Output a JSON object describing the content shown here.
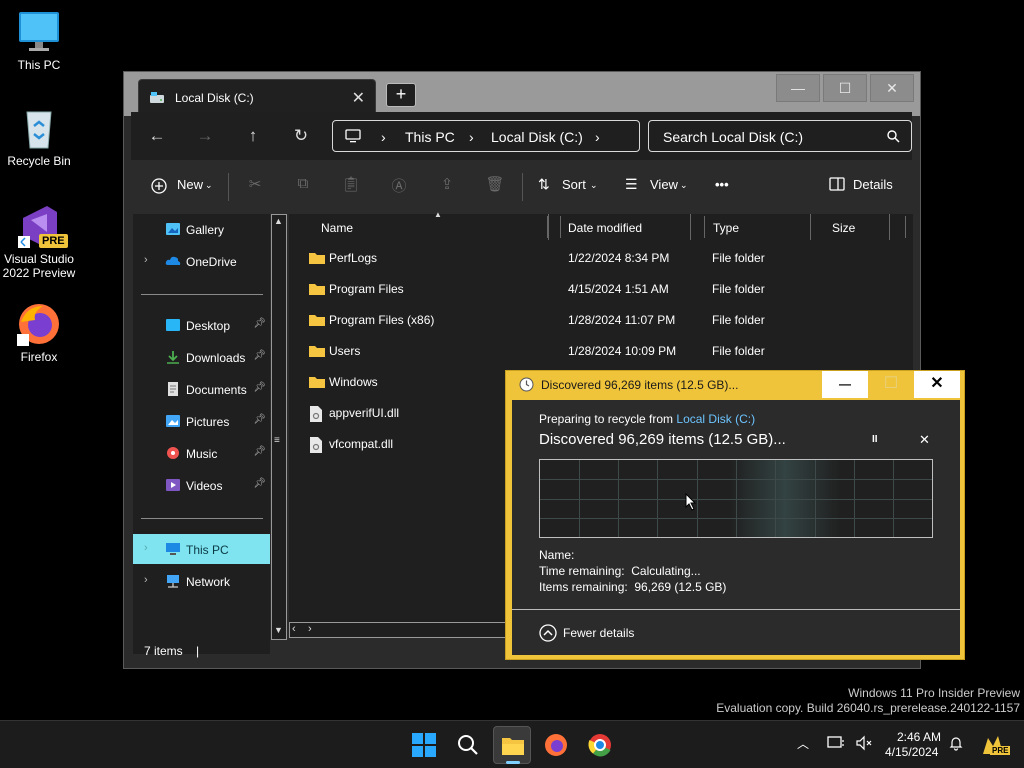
{
  "desktop": {
    "icons": [
      {
        "label": "This PC"
      },
      {
        "label": "Recycle Bin"
      },
      {
        "label": "Visual Studio 2022 Preview"
      },
      {
        "label": "Firefox"
      }
    ],
    "vs_badge": "PRE",
    "watermark": {
      "line1": "Windows 11 Pro Insider Preview",
      "line2": "Evaluation copy. Build 26040.rs_prerelease.240122-1157"
    }
  },
  "explorer": {
    "tab_title": "Local Disk (C:)",
    "tab_close": "✕",
    "new_tab": "+",
    "window_buttons": {
      "minimize": "—",
      "maximize": "☐",
      "close": "✕"
    },
    "nav": {
      "back": "←",
      "forward": "→",
      "up": "↑",
      "refresh": "↻"
    },
    "address": {
      "segments": [
        "This PC",
        "Local Disk (C:)"
      ],
      "separator": "›"
    },
    "search": {
      "placeholder": "Search Local Disk (C:)"
    },
    "toolbar": {
      "new_label": "New",
      "sort_label": "Sort",
      "view_label": "View",
      "more_label": "•••",
      "details_label": "Details"
    },
    "sidebar": {
      "items": [
        {
          "label": "Gallery"
        },
        {
          "label": "OneDrive"
        },
        {
          "label": "Desktop"
        },
        {
          "label": "Downloads"
        },
        {
          "label": "Documents"
        },
        {
          "label": "Pictures"
        },
        {
          "label": "Music"
        },
        {
          "label": "Videos"
        },
        {
          "label": "This PC"
        },
        {
          "label": "Network"
        }
      ]
    },
    "columns": {
      "name": "Name",
      "date": "Date modified",
      "type": "Type",
      "size": "Size"
    },
    "files": [
      {
        "name": "PerfLogs",
        "date": "1/22/2024 8:34 PM",
        "type": "File folder"
      },
      {
        "name": "Program Files",
        "date": "4/15/2024 1:51 AM",
        "type": "File folder"
      },
      {
        "name": "Program Files (x86)",
        "date": "1/28/2024 11:07 PM",
        "type": "File folder"
      },
      {
        "name": "Users",
        "date": "1/28/2024 10:09 PM",
        "type": "File folder"
      },
      {
        "name": "Windows",
        "date": "",
        "type": ""
      },
      {
        "name": "appverifUI.dll",
        "date": "",
        "type": ""
      },
      {
        "name": "vfcompat.dll",
        "date": "",
        "type": ""
      }
    ],
    "status": "7 items"
  },
  "dialog": {
    "title": "Discovered 96,269 items (12.5 GB)...",
    "buttons": {
      "minimize": "—",
      "close": "✕"
    },
    "preparing_prefix": "Preparing to recycle from ",
    "preparing_link": "Local Disk (C:)",
    "headline": "Discovered 96,269 items (12.5 GB)...",
    "pause": "II",
    "cancel": "✕",
    "name_label": "Name:",
    "time_remaining": "Time remaining:  Calculating...",
    "items_remaining": "Items remaining:  96,269 (12.5 GB)",
    "fewer_details": "Fewer details"
  },
  "taskbar": {
    "time": "2:46 AM",
    "date": "4/15/2024",
    "pre_badge": "PRE"
  },
  "colors": {
    "dialog_accent": "#f0c43a",
    "selected_item": "#7fe3f0",
    "link": "#6cc4ff",
    "folder": "#f5c542"
  }
}
